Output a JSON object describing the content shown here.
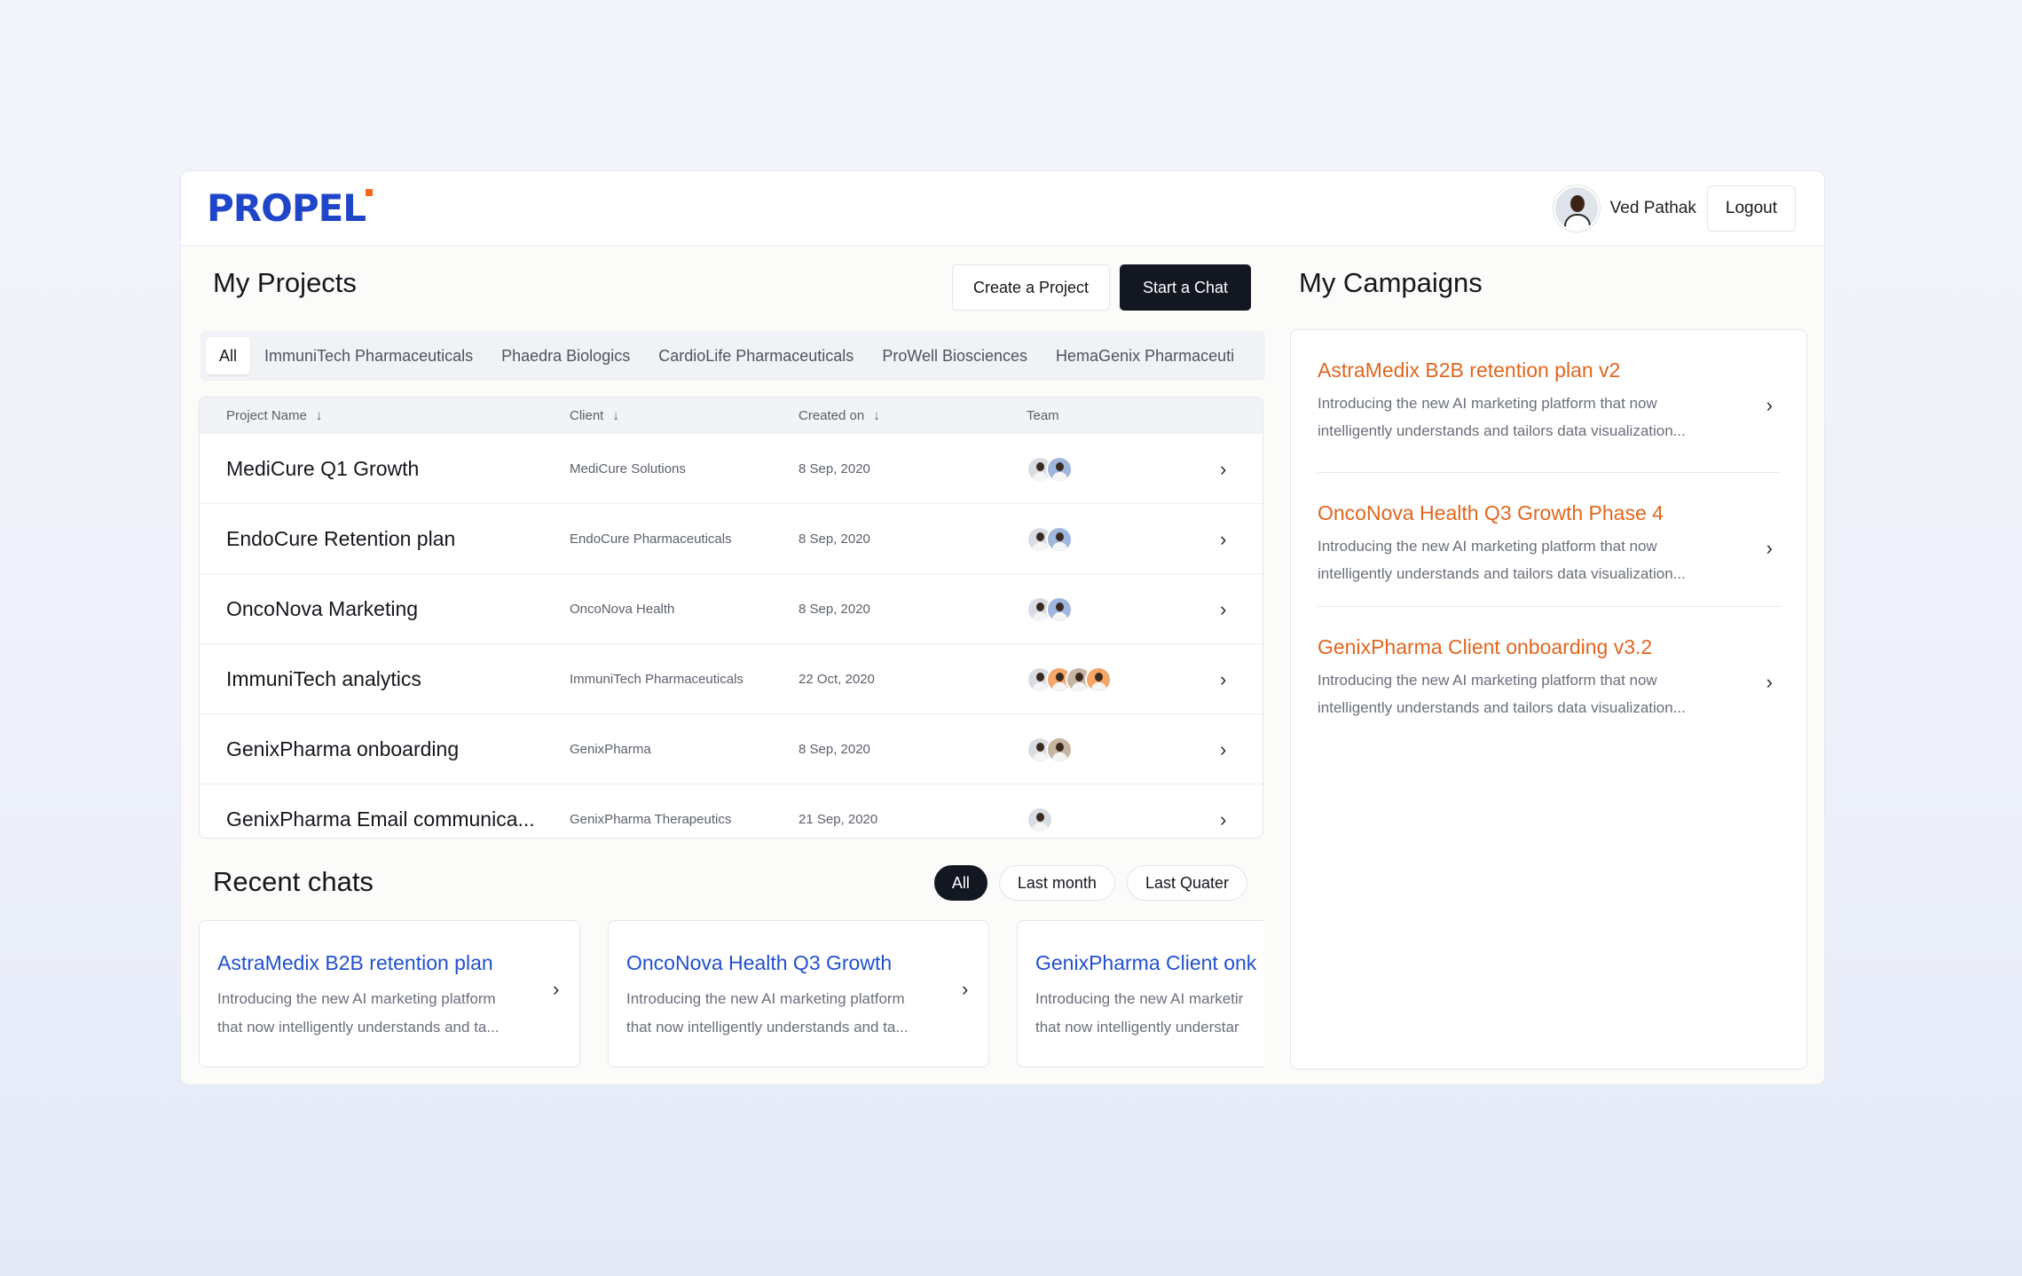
{
  "brand": {
    "name": "PROPEL",
    "accent": "#1f46c8",
    "dot_color": "#f2661d"
  },
  "user": {
    "name": "Ved Pathak",
    "logout_label": "Logout"
  },
  "projects": {
    "title": "My Projects",
    "create_label": "Create a Project",
    "chat_label": "Start a Chat",
    "filters": [
      "All",
      "ImmuniTech Pharmaceuticals",
      "Phaedra Biologics",
      "CardioLife Pharmaceuticals",
      "ProWell Biosciences",
      "HemaGenix Pharmaceuti"
    ],
    "columns": {
      "name": "Project Name",
      "client": "Client",
      "created": "Created on",
      "team": "Team"
    },
    "rows": [
      {
        "name": "MediCure Q1 Growth",
        "client": "MediCure Solutions",
        "date": "8 Sep, 2020"
      },
      {
        "name": "EndoCure Retention plan",
        "client": "EndoCure Pharmaceuticals",
        "date": "8 Sep, 2020"
      },
      {
        "name": "OncoNova Marketing",
        "client": "OncoNova Health",
        "date": "8 Sep, 2020"
      },
      {
        "name": "ImmuniTech analytics",
        "client": "ImmuniTech Pharmaceuticals",
        "date": "22 Oct, 2020"
      },
      {
        "name": "GenixPharma onboarding",
        "client": "GenixPharma",
        "date": "8 Sep, 2020"
      },
      {
        "name": "GenixPharma Email communica...",
        "client": "GenixPharma Therapeutics",
        "date": "21 Sep, 2020"
      }
    ]
  },
  "chats": {
    "title": "Recent chats",
    "filters": [
      "All",
      "Last month",
      "Last Quater"
    ],
    "cards": [
      {
        "title": "AstraMedix B2B retention plan",
        "desc_line1": "Introducing the new AI marketing platform",
        "desc_line2": "that now intelligently understands and ta..."
      },
      {
        "title": "OncoNova Health Q3 Growth",
        "desc_line1": "Introducing the new AI marketing platform",
        "desc_line2": "that now intelligently understands and ta..."
      },
      {
        "title": "GenixPharma Client onk",
        "desc_line1": "Introducing the new AI marketir",
        "desc_line2": "that now intelligently understar"
      }
    ]
  },
  "campaigns": {
    "title": "My Campaigns",
    "items": [
      {
        "title": "AstraMedix B2B retention plan v2",
        "desc_line1": "Introducing the new AI marketing platform that now",
        "desc_line2": "intelligently understands and tailors data visualization..."
      },
      {
        "title": "OncoNova Health Q3 Growth Phase 4",
        "desc_line1": "Introducing the new AI marketing platform that now",
        "desc_line2": "intelligently understands and tailors data visualization..."
      },
      {
        "title": "GenixPharma Client onboarding v3.2",
        "desc_line1": "Introducing the new AI marketing platform that now",
        "desc_line2": "intelligently understands and tailors data visualization..."
      }
    ]
  },
  "icons": {
    "chevron": "chevron-right-icon",
    "sort": "arrow-down-icon"
  }
}
